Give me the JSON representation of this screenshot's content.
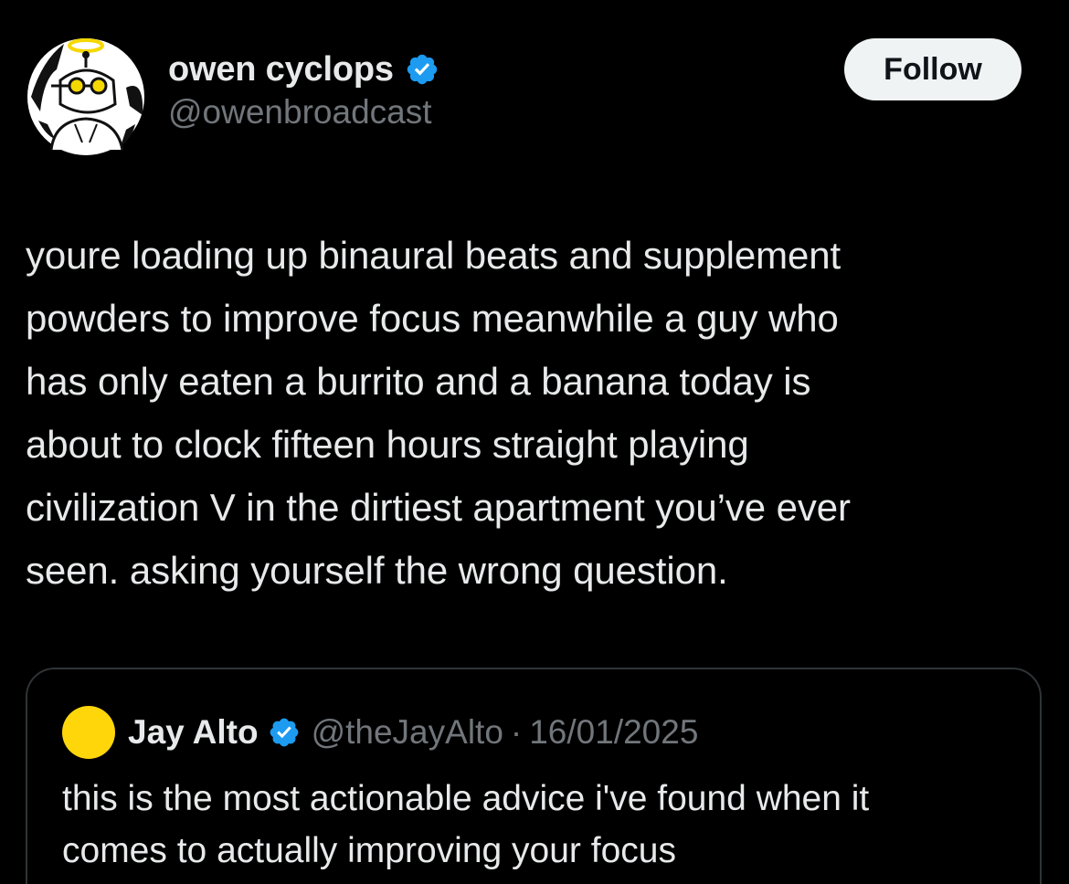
{
  "author": {
    "display_name": "owen cyclops",
    "handle": "@owenbroadcast",
    "verified_icon": "verified-badge-icon",
    "avatar_icon": "cartoon-character-avatar"
  },
  "follow_label": "Follow",
  "tweet_text": "youre loading up binaural beats and supplement\npowders to improve focus meanwhile a guy who\nhas only eaten a burrito and a banana today is\nabout to clock fifteen hours straight playing\ncivilization V in the dirtiest apartment you’ve ever\nseen. asking yourself the wrong question.",
  "quote": {
    "display_name": "Jay Alto",
    "handle": "@theJayAlto",
    "separator": "·",
    "date": "16/01/2025",
    "text": "this is the most actionable advice i've found when it\ncomes to actually improving your focus",
    "avatar_color": "#ffd60a"
  },
  "colors": {
    "background": "#000000",
    "primary_text": "#e7e9ea",
    "secondary_text": "#71767b",
    "verified_blue": "#1d9bf0",
    "button_bg": "#eff3f4"
  }
}
